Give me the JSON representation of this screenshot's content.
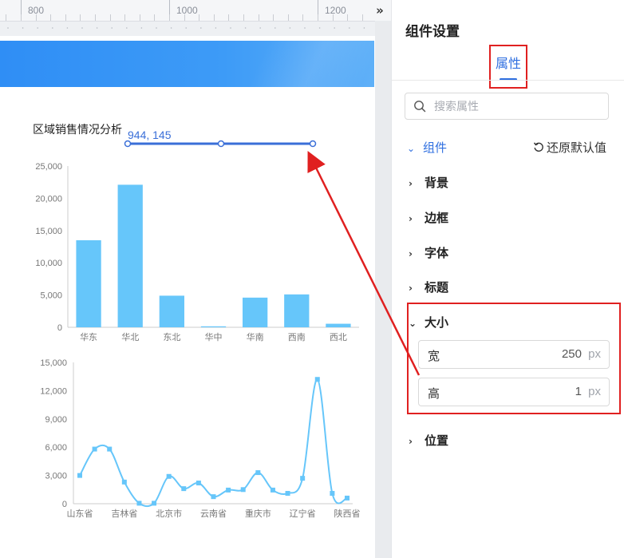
{
  "ruler": {
    "labels": [
      "800",
      "1000",
      "1200"
    ],
    "expand_icon": "double-chevron-right-icon"
  },
  "canvas": {
    "banner_color": "#3d9bf7",
    "component_title": "区域销售情况分析",
    "coordinate_readout": "944, 145"
  },
  "chart_data": [
    {
      "type": "bar",
      "categories": [
        "华东",
        "华北",
        "东北",
        "华中",
        "华南",
        "西南",
        "西北"
      ],
      "values": [
        13500,
        22100,
        4900,
        150,
        4600,
        5100,
        550
      ],
      "ylim": [
        0,
        25000
      ],
      "yticks": [
        "0",
        "5,000",
        "10,000",
        "15,000",
        "20,000",
        "25,000"
      ],
      "color": "#66c6fa",
      "grid": false,
      "legend": "none"
    },
    {
      "type": "line",
      "x_labels": [
        "山东省",
        "吉林省",
        "北京市",
        "云南省",
        "重庆市",
        "辽宁省",
        "陕西省"
      ],
      "values": [
        3000,
        5800,
        5800,
        2300,
        50,
        50,
        2900,
        1600,
        2200,
        750,
        1450,
        1500,
        3300,
        1450,
        1100,
        2700,
        13200,
        1100,
        600
      ],
      "ylim": [
        0,
        15000
      ],
      "yticks": [
        "0",
        "3,000",
        "6,000",
        "9,000",
        "12,000",
        "15,000"
      ],
      "color": "#66c6fa",
      "smooth": true,
      "grid": false,
      "legend": "none"
    }
  ],
  "panel": {
    "title": "组件设置",
    "active_tab": "属性",
    "search_placeholder": "搜索属性",
    "group_label": "组件",
    "reset_label": "还原默认值",
    "sections": [
      "背景",
      "边框",
      "字体",
      "标题"
    ],
    "size_section": "大小",
    "width_label": "宽",
    "width_value": "250",
    "height_label": "高",
    "height_value": "1",
    "unit": "px",
    "position_section": "位置"
  },
  "colors": {
    "accent": "#2f6fe0",
    "highlight_red": "#e02020",
    "chart_blue": "#66c6fa"
  }
}
